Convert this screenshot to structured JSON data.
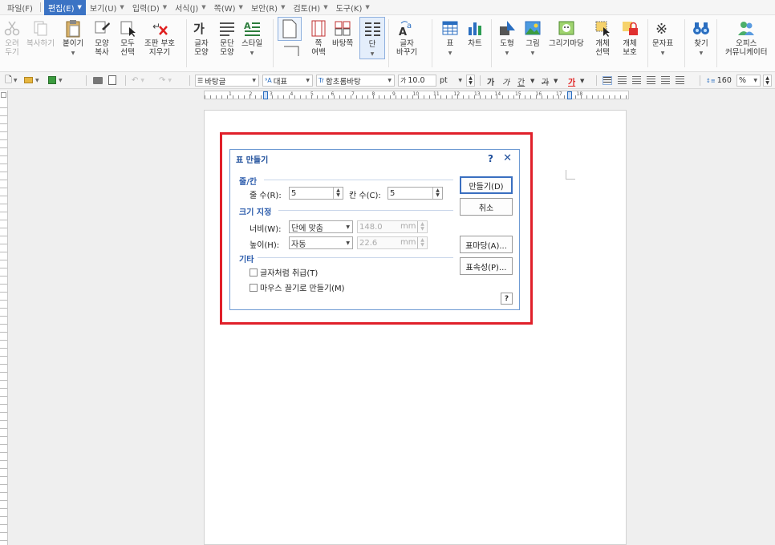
{
  "menubar": {
    "items": [
      "파일(F)",
      "편집(E)",
      "보기(U)",
      "입력(D)",
      "서식(J)",
      "쪽(W)",
      "보안(R)",
      "검토(H)",
      "도구(K)"
    ],
    "active_index": 1
  },
  "ribbon": {
    "cut": "오려\n두기",
    "copy": "복사하기",
    "paste": "붙이기",
    "format_copy": "모양\n복사",
    "select_all": "모두\n선택",
    "clear_marks": "조판 부호\n지우기",
    "char_shape": "글자\n모양",
    "para_shape": "문단\n모양",
    "style": "스타일",
    "page_margin": "쪽\n여백",
    "background": "바탕쪽",
    "column": "단",
    "change_case": "글자\n바꾸기",
    "table": "표",
    "chart": "차트",
    "shape": "도형",
    "picture": "그림",
    "drawing_madang": "그리기마당",
    "object_select": "개체\n선택",
    "object_protect": "개체\n보호",
    "symbol": "문자표",
    "find": "찾기",
    "office_communicator": "오피스\n커뮤니케이터"
  },
  "toolbar2": {
    "style": "바탕글",
    "lang": "대표",
    "font": "함초롬바탕",
    "size": "10.0",
    "unit": "pt",
    "zoom": "160",
    "zoom_unit": "%",
    "bold": "가",
    "italic": "가",
    "underline": "간",
    "strike": "가",
    "color": "가"
  },
  "ruler_numbers": [
    "1",
    "2",
    "3",
    "4",
    "5",
    "6",
    "7",
    "8",
    "9",
    "10",
    "11",
    "12",
    "13",
    "14",
    "15",
    "16",
    "17",
    "18"
  ],
  "dialog": {
    "title": "표 만들기",
    "help_mark": "?",
    "close": "✕",
    "section_rowcol": "줄/칸",
    "rows_label": "줄 수(R):",
    "rows_value": "5",
    "cols_label": "칸 수(C):",
    "cols_value": "5",
    "section_size": "크기 지정",
    "width_label": "너비(W):",
    "width_option": "단에 맞춤",
    "width_value": "148.0",
    "width_unit": "mm",
    "height_label": "높이(H):",
    "height_option": "자동",
    "height_value": "22.6",
    "height_unit": "mm",
    "section_etc": "기타",
    "treat_as_char": "글자처럼 취급(T)",
    "mouse_drag": "마우스 끌기로 만들기(M)",
    "btn_create": "만들기(D)",
    "btn_cancel": "취소",
    "btn_table_madang": "표마당(A)...",
    "btn_props": "표속성(P)...",
    "help_button": "?"
  },
  "colors": {
    "accent": "#3b73c4",
    "highlight": "#e0202a",
    "dialog_title": "#1f4f9b"
  }
}
